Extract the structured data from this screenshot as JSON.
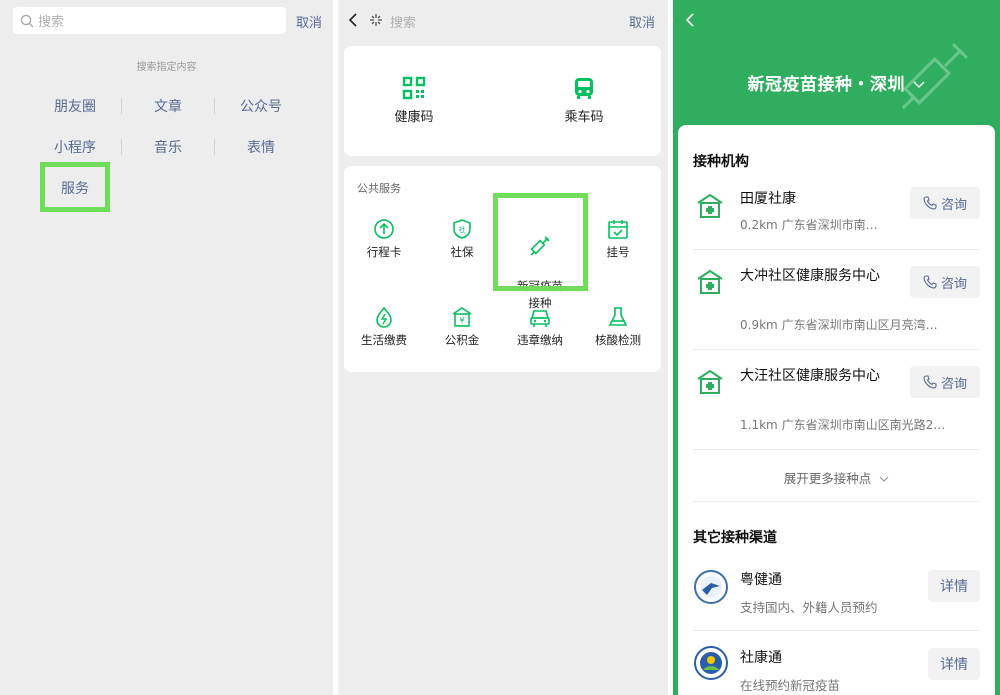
{
  "panel1": {
    "search_placeholder": "搜索",
    "cancel_label": "取消",
    "hint": "搜索指定内容",
    "categories": [
      "朋友圈",
      "文章",
      "公众号",
      "小程序",
      "音乐",
      "表情",
      "服务"
    ],
    "highlight_color": "#6fdc5a",
    "link_color": "#576b95"
  },
  "panel2": {
    "search_placeholder": "搜索",
    "cancel_label": "取消",
    "quick": [
      {
        "label": "健康码",
        "icon": "qr-code-icon"
      },
      {
        "label": "乘车码",
        "icon": "bus-icon"
      }
    ],
    "public_title": "公共服务",
    "services": [
      {
        "label": "行程卡",
        "icon": "arrow-up-circle-icon"
      },
      {
        "label": "社保",
        "icon": "shield-icon"
      },
      {
        "label": "新冠疫苗\n接种",
        "icon": "syringe-icon"
      },
      {
        "label": "挂号",
        "icon": "calendar-check-icon"
      },
      {
        "label": "生活缴费",
        "icon": "bolt-drop-icon"
      },
      {
        "label": "公积金",
        "icon": "house-yen-icon"
      },
      {
        "label": "违章缴纳",
        "icon": "car-icon"
      },
      {
        "label": "核酸检测",
        "icon": "flask-icon"
      }
    ],
    "accent_color": "#07c160"
  },
  "panel3": {
    "title": "新冠疫苗接种・深圳",
    "section1_title": "接种机构",
    "orgs": [
      {
        "name": "田厦社康",
        "dist": "0.2km",
        "addr": "广东省深圳市南…",
        "btn": "咨询"
      },
      {
        "name": "大冲社区健康服务中心",
        "dist": "0.9km",
        "addr": "广东省深圳市南山区月亮湾…",
        "btn": "咨询"
      },
      {
        "name": "大汪社区健康服务中心",
        "dist": "1.1km",
        "addr": "广东省深圳市南山区南光路2…",
        "btn": "咨询"
      }
    ],
    "more_label": "展开更多接种点",
    "section2_title": "其它接种渠道",
    "channels": [
      {
        "name": "粤健通",
        "desc": "支持国内、外籍人员预约",
        "btn": "详情"
      },
      {
        "name": "社康通",
        "desc": "在线预约新冠疫苗",
        "btn": "详情"
      }
    ],
    "bg_color": "#2fae5f"
  }
}
